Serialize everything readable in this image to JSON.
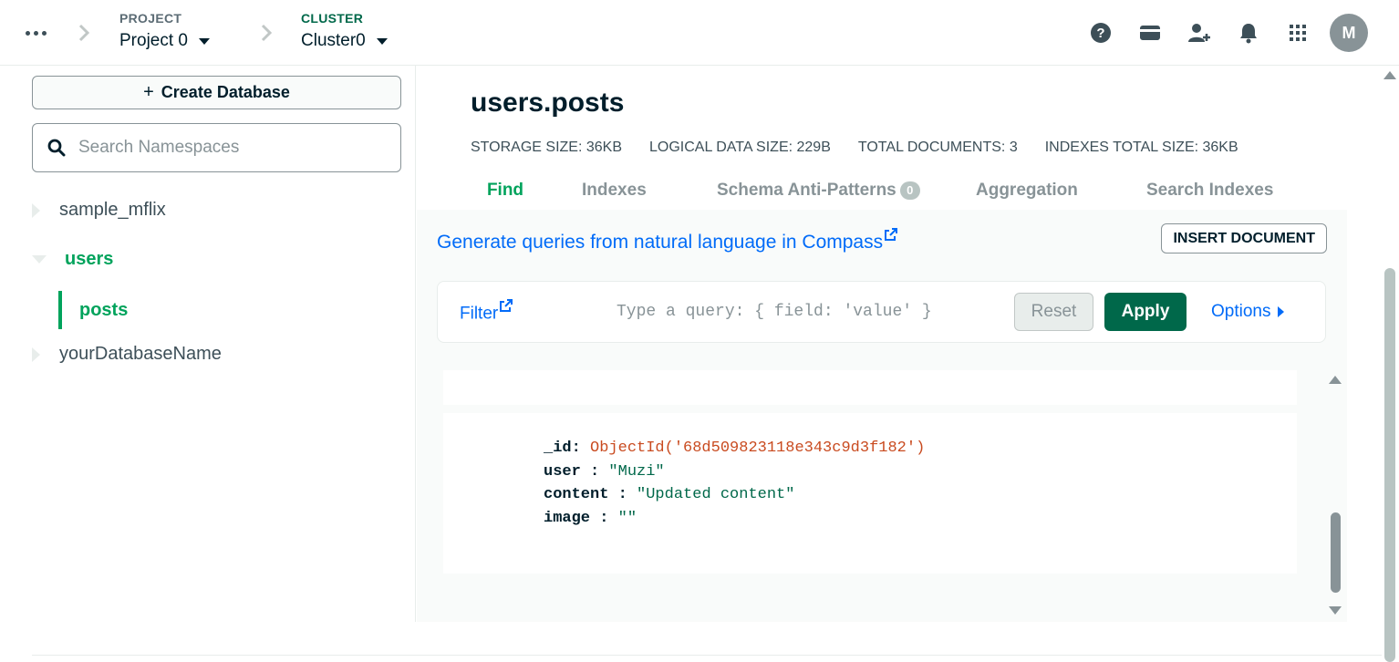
{
  "topbar": {
    "project_label": "PROJECT",
    "project_value": "Project 0",
    "cluster_label": "CLUSTER",
    "cluster_value": "Cluster0",
    "icons": [
      "help-icon",
      "billing-card-icon",
      "invite-user-icon",
      "notifications-bell-icon",
      "apps-grid-icon"
    ],
    "avatar_initial": "M"
  },
  "sidebar": {
    "create_label": "Create Database",
    "create_icon": "+",
    "search_placeholder": "Search Namespaces",
    "databases": [
      {
        "name": "sample_mflix",
        "expanded": false
      },
      {
        "name": "users",
        "expanded": true,
        "collections": [
          "posts"
        ]
      },
      {
        "name": "yourDatabaseName",
        "expanded": false
      }
    ]
  },
  "collection": {
    "title": "users.posts",
    "stats": {
      "storage": "STORAGE SIZE: 36KB",
      "logical": "LOGICAL DATA SIZE: 229B",
      "documents": "TOTAL DOCUMENTS: 3",
      "indexes": "INDEXES TOTAL SIZE: 36KB"
    },
    "tabs": [
      {
        "label": "Find",
        "active": true
      },
      {
        "label": "Indexes",
        "active": false
      },
      {
        "label": "Schema Anti-Patterns",
        "badge": "0",
        "active": false
      },
      {
        "label": "Aggregation",
        "active": false
      },
      {
        "label": "Search Indexes",
        "active": false
      }
    ]
  },
  "find": {
    "nl_link": "Generate queries from natural language in Compass",
    "insert_label": "INSERT DOCUMENT",
    "filter_label": "Filter",
    "query_placeholder": "Type a query: { field: 'value' }",
    "reset_label": "Reset",
    "apply_label": "Apply",
    "options_label": "Options"
  },
  "document": {
    "fields": [
      {
        "key": "_id",
        "sep": ": ",
        "value": "ObjectId('68d509823118e343c9d3f182')",
        "type": "oid"
      },
      {
        "key": "user",
        "sep": " : ",
        "value": "\"Muzi\"",
        "type": "str"
      },
      {
        "key": "content",
        "sep": " : ",
        "value": "\"Updated content\"",
        "type": "str"
      },
      {
        "key": "image",
        "sep": " : ",
        "value": "\"\"",
        "type": "str"
      }
    ]
  },
  "colors": {
    "accent_green": "#00a35c",
    "dark_green": "#00684a",
    "link_blue": "#016bf8",
    "objectid_red": "#c94b20"
  }
}
